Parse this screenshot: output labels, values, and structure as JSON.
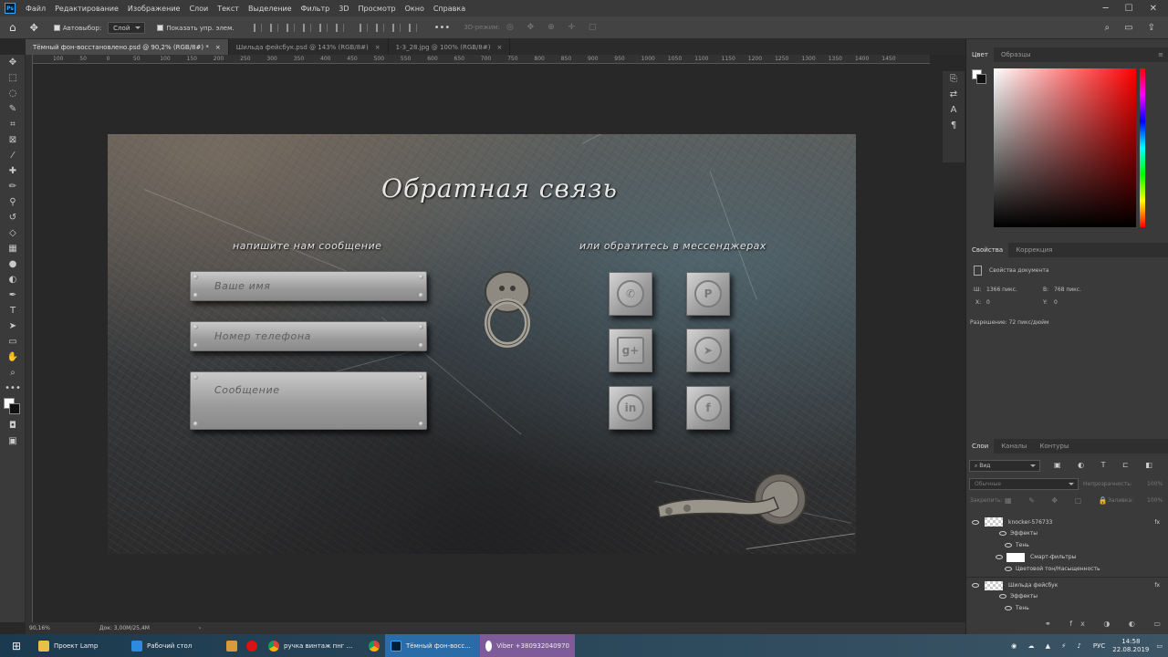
{
  "menu": {
    "items": [
      "Файл",
      "Редактирование",
      "Изображение",
      "Слои",
      "Текст",
      "Выделение",
      "Фильтр",
      "3D",
      "Просмотр",
      "Окно",
      "Справка"
    ]
  },
  "options": {
    "autoselect_label": "Автовыбор:",
    "layer_dropdown": "Слой",
    "show_controls_label": "Показать упр. элем.",
    "mode_3d_label": "3D-режим:"
  },
  "tabs": [
    {
      "label": "Тёмный фон-восстановлено.psd @ 90,2% (RGB/8#) *",
      "close": "×"
    },
    {
      "label": "Шильда фейсбук.psd @ 143% (RGB/8#)",
      "close": "×"
    },
    {
      "label": "1-3_28.jpg @ 100% (RGB/8#)",
      "close": "×"
    }
  ],
  "ruler": {
    "ticks": [
      "100",
      "50",
      "0",
      "50",
      "100",
      "150",
      "200",
      "250",
      "300",
      "350",
      "400",
      "450",
      "500",
      "550",
      "600",
      "650",
      "700",
      "750",
      "800",
      "850",
      "900",
      "950",
      "1000",
      "1050",
      "1100",
      "1150",
      "1200",
      "1250",
      "1300",
      "1350",
      "1400",
      "1450"
    ]
  },
  "canvas": {
    "title": "Обратная связь",
    "left_heading": "напишите нам сообщение",
    "right_heading": "или обратитесь в мессенджерах",
    "fields": {
      "name": "Ваше имя",
      "phone": "Номер телефона",
      "message": "Сообщение"
    },
    "icons": [
      "viber-icon",
      "pinterest-icon",
      "google-plus-icon",
      "telegram-icon",
      "linkedin-icon",
      "facebook-icon"
    ],
    "icon_glyphs": [
      "✆",
      "P",
      "g+",
      "➤",
      "in",
      "f"
    ]
  },
  "status": {
    "zoom": "90,16%",
    "doc": "Док: 3,00M/25,4M"
  },
  "color_panel": {
    "tabs": [
      "Цвет",
      "Образцы"
    ]
  },
  "properties_panel": {
    "tabs": [
      "Свойства",
      "Коррекция"
    ],
    "doc_label": "Свойства документа",
    "w_label": "Ш:",
    "w_value": "1366 пикс.",
    "h_label": "В:",
    "h_value": "768 пикс.",
    "x_label": "X:",
    "x_value": "0",
    "y_label": "Y:",
    "y_value": "0",
    "resolution": "Разрешение: 72 пикс/дюйм"
  },
  "layers_panel": {
    "tabs": [
      "Слои",
      "Каналы",
      "Контуры"
    ],
    "filter": "Вид",
    "blend": "Обычные",
    "opacity_label": "Непрозрачность:",
    "opacity": "100%",
    "lock_label": "Закрепить:",
    "fill_label": "Заливка:",
    "fill": "100%",
    "layers": [
      "knocker-576733",
      "Эффекты",
      "Тень",
      "Смарт-фильтры",
      "Цветовой тон/Насыщенность",
      "Шильда фейсбук",
      "Эффекты",
      "Тень"
    ]
  },
  "taskbar": {
    "items": [
      "Проект Lamp",
      "Рабочий стол",
      "ручка винтаж пнг ...",
      "Тёмный фон-восс...",
      "Viber +380932040970"
    ],
    "lang": "РУС",
    "time": "14:58",
    "date": "22.08.2019"
  }
}
